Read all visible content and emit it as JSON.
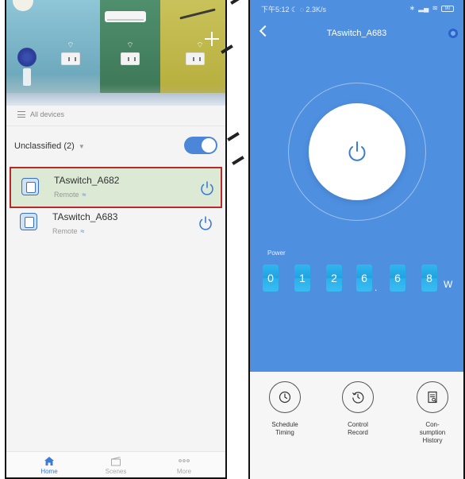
{
  "left_app": {
    "header": {
      "all_devices_label": "All devices",
      "add_icon": "plus-icon"
    },
    "group": {
      "label": "Unclassified (2)",
      "toggle_on": true
    },
    "devices": [
      {
        "name": "TAswitch_A682",
        "status": "Remote",
        "icon": "switch-icon",
        "highlighted": true
      },
      {
        "name": "TAswitch_A683",
        "status": "Remote",
        "icon": "switch-icon",
        "highlighted": false
      }
    ],
    "tabs": [
      {
        "label": "Home",
        "icon": "home-icon",
        "active": true
      },
      {
        "label": "Scenes",
        "icon": "scenes-icon",
        "active": false
      },
      {
        "label": "More",
        "icon": "more-icon",
        "active": false
      }
    ]
  },
  "right_app": {
    "statusbar": {
      "left": "下午5:12 ☾ ◌  2.3K/s",
      "battery": "90"
    },
    "header": {
      "title": "TAswitch_A683"
    },
    "power": {
      "label": "Power",
      "digits": [
        "0",
        "1",
        "2",
        "6",
        "6",
        "8"
      ],
      "decimal": ".",
      "unit": "W"
    },
    "actions": [
      {
        "label": "Schedule\nTiming",
        "icon": "clock-icon"
      },
      {
        "label": "Control\nRecord",
        "icon": "history-icon"
      },
      {
        "label": "Con-\nsumption\nHistory",
        "icon": "document-icon"
      }
    ]
  },
  "colors": {
    "accent_blue": "#4e8fe0",
    "digit_blue": "#2cb0ea",
    "highlight_border": "#b82a2a",
    "highlight_bg": "#dbe9d5"
  }
}
